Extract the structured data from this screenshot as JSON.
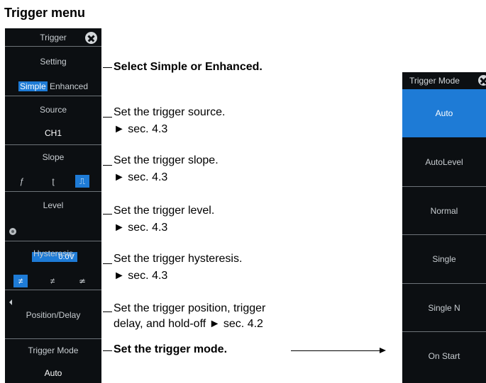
{
  "title": "Trigger menu",
  "menu": {
    "header": "Trigger",
    "setting_label": "Setting",
    "setting_simple": "Simple",
    "setting_enhanced": "Enhanced",
    "source_label": "Source",
    "source_value": "CH1",
    "slope_label": "Slope",
    "slope_icons": [
      "rising-edge-icon",
      "falling-edge-icon",
      "both-edges-icon"
    ],
    "level_label": "Level",
    "level_value": "0.0V",
    "hysteresis_label": "Hysteresis",
    "hysteresis_icons": [
      "hysteresis-low-icon",
      "hysteresis-mid-icon",
      "hysteresis-high-icon"
    ],
    "position_label": "Position/Delay",
    "trigger_mode_label": "Trigger Mode",
    "trigger_mode_value": "Auto"
  },
  "annotations": {
    "setting": "Select Simple or Enhanced.",
    "source_1": "Set the trigger source.",
    "source_2": "► sec. 4.3",
    "slope_1": "Set the trigger slope.",
    "slope_2": "► sec. 4.3",
    "level_1": "Set the trigger level.",
    "level_2": "► sec. 4.3",
    "hysteresis_1": "Set the trigger hysteresis.",
    "hysteresis_2": "► sec. 4.3",
    "position_1": "Set the trigger position, trigger",
    "position_2": "delay, and hold-off ► sec. 4.2",
    "mode": "Set the trigger mode."
  },
  "mode_menu": {
    "header": "Trigger Mode",
    "options": [
      "Auto",
      "AutoLevel",
      "Normal",
      "Single",
      "Single N",
      "On Start"
    ],
    "selected": "Auto"
  },
  "colors": {
    "panel": "#0c0f12",
    "accent": "#1e7bd6",
    "divider": "#6d7378"
  }
}
